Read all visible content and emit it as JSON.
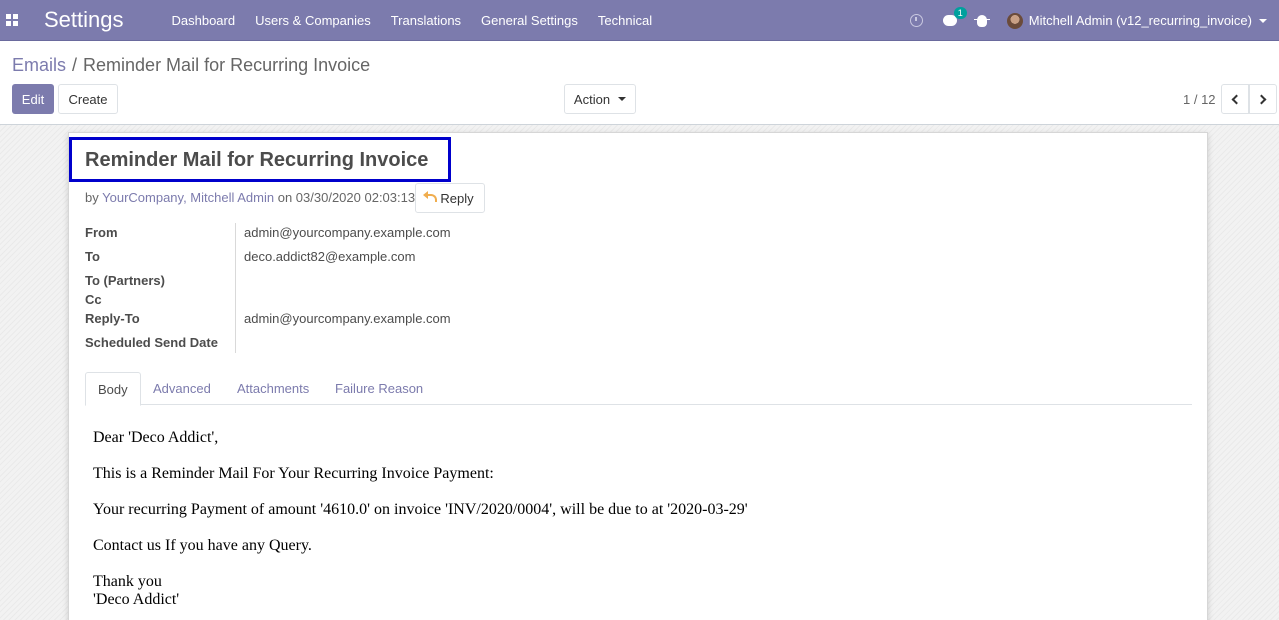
{
  "navbar": {
    "brand": "Settings",
    "menu": [
      "Dashboard",
      "Users & Companies",
      "Translations",
      "General Settings",
      "Technical"
    ],
    "chat_badge": "1",
    "user": "Mitchell Admin (v12_recurring_invoice)"
  },
  "breadcrumb": {
    "parent": "Emails",
    "separator": "/",
    "current": "Reminder Mail for Recurring Invoice"
  },
  "buttons": {
    "edit": "Edit",
    "create": "Create",
    "action": "Action"
  },
  "pager": {
    "value": "1 / 12"
  },
  "mail": {
    "title": "Reminder Mail for Recurring Invoice",
    "by_prefix": "by",
    "authors": "YourCompany, Mitchell Admin",
    "on_date": "on 03/30/2020 02:03:13",
    "reply_label": "Reply",
    "fields": [
      {
        "label": "From",
        "value": "admin@yourcompany.example.com"
      },
      {
        "label": "To",
        "value": "deco.addict82@example.com"
      },
      {
        "label": "To (Partners)",
        "value": ""
      },
      {
        "label": "Cc",
        "value": ""
      },
      {
        "label": "Reply-To",
        "value": "admin@yourcompany.example.com"
      },
      {
        "label": "Scheduled Send Date",
        "value": ""
      }
    ],
    "tabs": [
      "Body",
      "Advanced",
      "Attachments",
      "Failure Reason"
    ],
    "active_tab": "Body",
    "body": [
      "Dear 'Deco Addict',",
      "This is a Reminder Mail For Your Recurring Invoice Payment:",
      "Your recurring Payment of amount '4610.0' on invoice 'INV/2020/0004', will be due to at '2020-03-29'",
      "Contact us If you have any Query.",
      "Thank you",
      "'Deco Addict'"
    ]
  },
  "colors": {
    "brand": "#7c7bad",
    "highlight_box": "#0000cc",
    "badge": "#00a09d"
  }
}
